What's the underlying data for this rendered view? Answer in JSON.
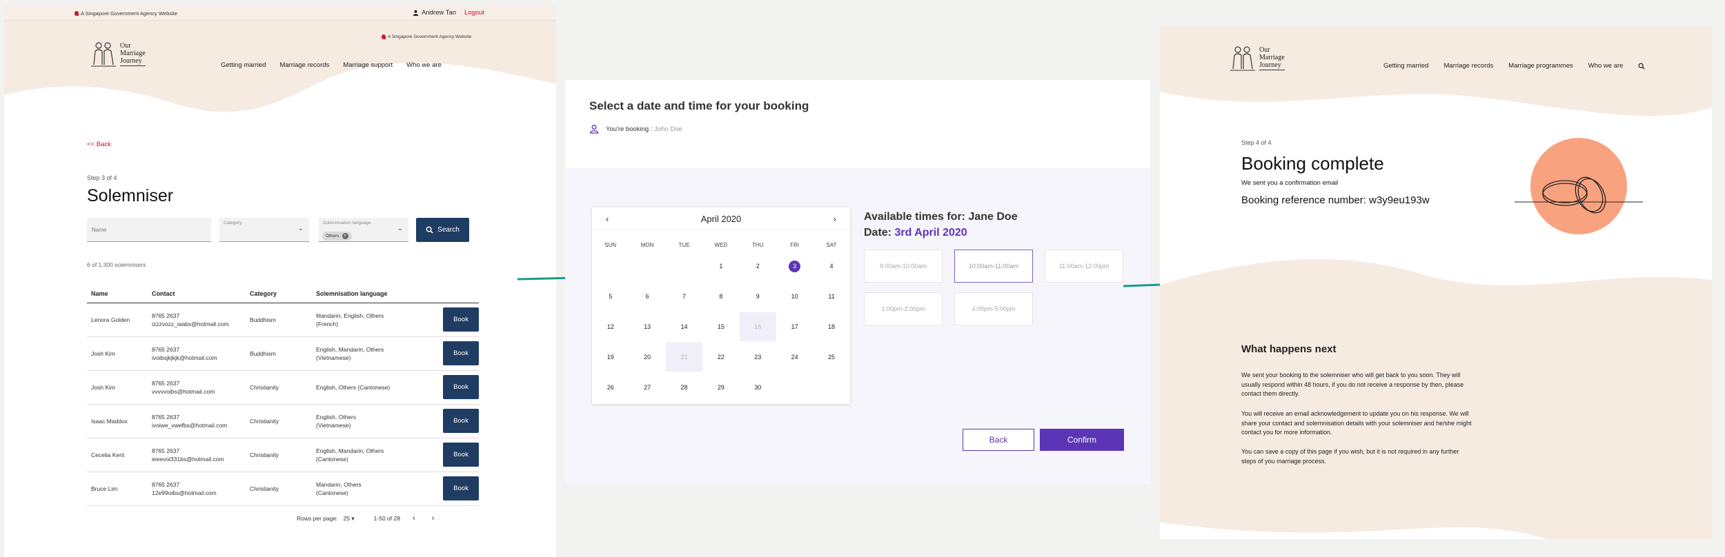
{
  "colors": {
    "navy": "#1f3d63",
    "purple": "#5b35b5",
    "peach": "#f6ebe1",
    "red": "#c4122f",
    "teal": "#179b87",
    "orange": "#f8a27f"
  },
  "panel1": {
    "gov_banner": "A Singapore Government Agency Website",
    "gov_banner_small": "A Singapore Government Agency Website",
    "user": {
      "name": "Andrew Tan",
      "logout": "Logout",
      "icon": "person-icon"
    },
    "logo": [
      "Our",
      "Marriage",
      "Journey"
    ],
    "nav": [
      "Getting married",
      "Marriage records",
      "Marriage support",
      "Who we are"
    ],
    "back": "<< Back",
    "step": "Step 3 of 4",
    "title": "Solemniser",
    "filters": {
      "name_placeholder": "Name",
      "category_label": "Category",
      "language_label": "Solemnisation language",
      "language_chip": "Others",
      "search_label": "Search"
    },
    "count": "6 of 1,300 solemnisers",
    "table": {
      "headers": [
        "Name",
        "Contact",
        "Category",
        "Solemnisation language"
      ],
      "book_label": "Book",
      "rows": [
        {
          "name": "Lenora Golden",
          "phone": "8765 2637",
          "email": "izzzvozz_iaabs@hotmail.com",
          "category": "Buddhism",
          "lang1": "Mandarin, English, Others",
          "lang2": "(French)"
        },
        {
          "name": "Josh Kim",
          "phone": "8765 2637",
          "email": "ivoibsjkjkjk@hotmail.com",
          "category": "Buddhism",
          "lang1": "English, Mandarin, Others",
          "lang2": "(Vietnamese)"
        },
        {
          "name": "Josh Kim",
          "phone": "8765 2637",
          "email": "vvvvvoibs@hotmail.com",
          "category": "Christianity",
          "lang1": "English, Others (Cantonese)",
          "lang2": ""
        },
        {
          "name": "Isaac Maddox",
          "phone": "8765 2637",
          "email": "ivoiwe_vwefbs@hotmail.com",
          "category": "Christianity",
          "lang1": "English,  Others",
          "lang2": "(Vietnamese)"
        },
        {
          "name": "Cecelia Kent",
          "phone": "8765 2637",
          "email": "ieeevoi331bs@hotmail.com",
          "category": "Christianity",
          "lang1": "English, Mandarin, Others",
          "lang2": "(Cantonese)"
        },
        {
          "name": "Bruce Lim",
          "phone": "8765 2637",
          "email": "12e99oibs@hotmail.com",
          "category": "Christianity",
          "lang1": "Mandarin, Others",
          "lang2": "(Cantonese)"
        }
      ]
    },
    "pager": {
      "rows_label": "Rows per page:",
      "rows_value": "25",
      "range": "1-50 of 28"
    }
  },
  "panel2": {
    "title": "Select a date and time for your booking",
    "booking_label": "You're booking :",
    "booking_name": "John Doe",
    "calendar": {
      "month": "April 2020",
      "dows": [
        "SUN",
        "MON",
        "TUE",
        "WED",
        "THU",
        "FRI",
        "SAT"
      ],
      "weeks": [
        [
          "",
          "",
          "",
          "1",
          "2",
          "3",
          "4"
        ],
        [
          "5",
          "6",
          "7",
          "8",
          "9",
          "10",
          "11"
        ],
        [
          "12",
          "13",
          "14",
          "15",
          "16",
          "17",
          "18"
        ],
        [
          "19",
          "20",
          "21",
          "22",
          "23",
          "24",
          "25"
        ],
        [
          "26",
          "27",
          "28",
          "29",
          "30",
          "",
          ""
        ]
      ],
      "selected": "3",
      "unavailable": [
        "16",
        "21"
      ]
    },
    "avail_label": "Available times for: Jane Doe",
    "date_label": "Date:",
    "date_value": "3rd April 2020",
    "slots": [
      "9:00am-10:00am",
      "10:00am-11:00am",
      "11:00am-12:00pm",
      "1:00pm-2:00pm",
      "4:00pm-5:00pm"
    ],
    "selected_slot": "10:00am-11:00am",
    "back_label": "Back",
    "confirm_label": "Confirm"
  },
  "panel3": {
    "logo": [
      "Our",
      "Marriage",
      "Journey"
    ],
    "nav": [
      "Getting married",
      "Marriage records",
      "Marriage programmes",
      "Who we are"
    ],
    "step": "Step 4 of 4",
    "title": "Booking complete",
    "sent": "We sent you a confirmation email",
    "reference": "Booking reference number: w3y9eu193w",
    "next_title": "What happens next",
    "paragraphs": [
      [
        "We sent your booking to the solemniser who will get back to you soon. They will",
        "usually respond within 48 hours, if you do not receive a response by then, please",
        "contact them directly."
      ],
      [
        "You will receive an email acknowledgement to update you on his response. We will",
        "share your contact and solemnisation details with your solemniser and he/she might",
        "contact you for more information."
      ],
      [
        "You can save a copy of this page if you wish, but it is not required in any further",
        "steps of you marriage process."
      ]
    ]
  }
}
